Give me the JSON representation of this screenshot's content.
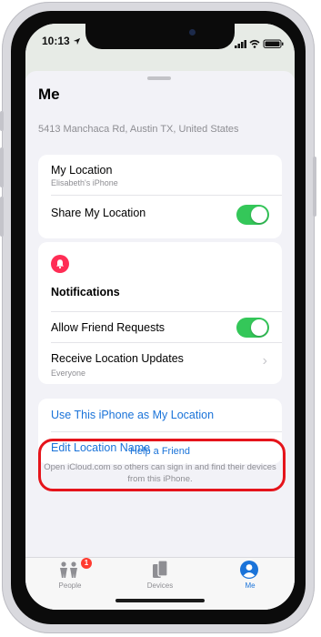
{
  "status_bar": {
    "time": "10:13"
  },
  "sheet": {
    "title": "Me",
    "address": "5413 Manchaca Rd, Austin TX, United States"
  },
  "location_card": {
    "my_location_label": "My Location",
    "device_name": "Elisabeth's iPhone",
    "share_label": "Share My Location",
    "share_on": true
  },
  "notifications_card": {
    "heading": "Notifications",
    "allow_requests_label": "Allow Friend Requests",
    "allow_requests_on": true,
    "receive_updates_label": "Receive Location Updates",
    "receive_updates_value": "Everyone"
  },
  "actions": {
    "use_iphone_label": "Use This iPhone as My Location",
    "edit_name_label": "Edit Location Name"
  },
  "help": {
    "title": "Help a Friend",
    "description": "Open iCloud.com so others can sign in and find their devices from this iPhone."
  },
  "tab_bar": {
    "tabs": [
      {
        "label": "People",
        "icon": "people-icon",
        "badge": "1"
      },
      {
        "label": "Devices",
        "icon": "devices-icon"
      },
      {
        "label": "Me",
        "icon": "me-icon",
        "active": true
      }
    ]
  },
  "colors": {
    "accent": "#1a73d9",
    "toggle_on": "#34c759",
    "highlight": "#e5141b",
    "bell": "#ff2d55"
  }
}
